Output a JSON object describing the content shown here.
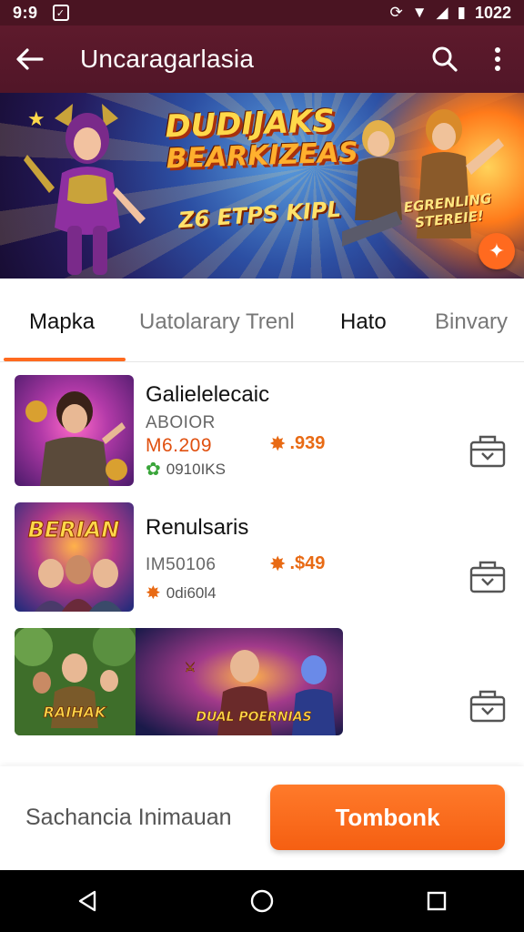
{
  "status_bar": {
    "time": "9:9",
    "clock": "1022"
  },
  "app_bar": {
    "title": "Uncaragarlasia"
  },
  "banner": {
    "headline_line1": "DUDIJAKS",
    "headline_line2": "BEARKIZEAS",
    "subline": "Z6 ETPS KIPL",
    "tagline": "EGRENLING STEREIE!"
  },
  "tabs": [
    {
      "label": "Mapka"
    },
    {
      "label": "Uatolarary Trenl"
    },
    {
      "label": "Hato"
    },
    {
      "label": "Binvary"
    }
  ],
  "items": [
    {
      "title": "Galielelecaic",
      "code": "ABOIOR",
      "price_main": "M6.209",
      "price_alt": ".939",
      "rating": "0910IKS",
      "thumb_caption": ""
    },
    {
      "title": "Renulsaris",
      "code": "IM50106",
      "price_alt": ".$49",
      "rating": "0di60l4",
      "thumb_caption": "BERIAN"
    },
    {
      "thumb_caption_left": "RAIHAK",
      "thumb_caption_right": "DUAL POERNIAS"
    }
  ],
  "bottom": {
    "hint": "Sachancia Inimauan",
    "cta": "Tombonk"
  },
  "colors": {
    "accent": "#ff6a1f",
    "app_bar": "#5e1a2c",
    "price": "#e86a14"
  }
}
